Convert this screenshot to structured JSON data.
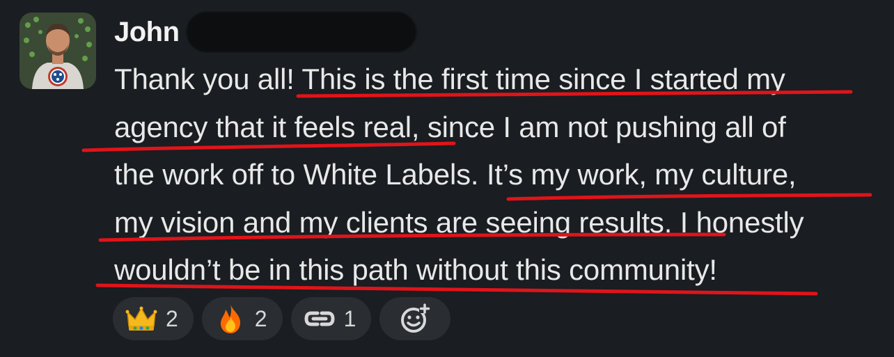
{
  "message": {
    "author": "John",
    "body_lines": [
      "Thank you all! This is the first time since I started my",
      "agency that it feels real, since I am not pushing all of",
      "the work off to White Labels. It’s my work, my culture,",
      "my vision and my clients are seeing results. I honestly",
      "wouldn’t be in this path without this community!"
    ]
  },
  "reactions": [
    {
      "icon": "crown-emoji-icon",
      "count": "2"
    },
    {
      "icon": "fire-emoji-icon",
      "count": "2"
    },
    {
      "icon": "link-emoji-icon",
      "count": "1"
    }
  ],
  "colors": {
    "background": "#1a1d21",
    "text": "#e8e8e8",
    "pill": "#2a2d31",
    "annotation": "#e0141a"
  }
}
